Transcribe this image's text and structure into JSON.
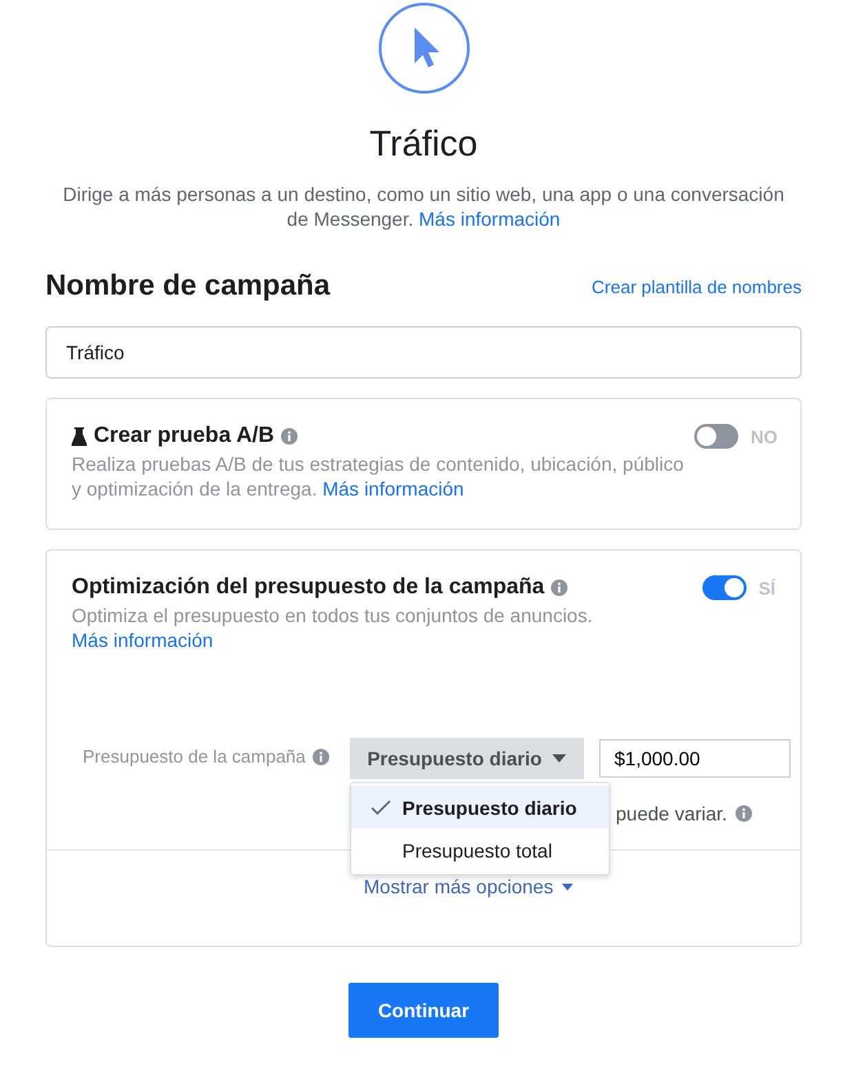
{
  "header": {
    "title": "Tráfico",
    "description": "Dirige a más personas a un destino, como un sitio web, una app o una conversación de Messenger.",
    "link": "Más información"
  },
  "campaign_name": {
    "heading": "Nombre de campaña",
    "template_link": "Crear plantilla de nombres",
    "value": "Tráfico"
  },
  "ab_test": {
    "title": "Crear prueba A/B",
    "description": "Realiza pruebas A/B de tus estrategias de contenido, ubicación, público y optimización de la entrega.",
    "link": "Más información",
    "on": false,
    "toggle_label": "NO"
  },
  "budget_optimization": {
    "title": "Optimización del presupuesto de la campaña",
    "description": "Optimiza el presupuesto en todos tus conjuntos de anuncios.",
    "link": "Más información",
    "on": true,
    "toggle_label": "SÍ",
    "budget_label": "Presupuesto de la campaña",
    "budget_type": "Presupuesto diario",
    "amount": "$1,000.00",
    "note": "puede variar.",
    "menu": [
      {
        "label": "Presupuesto diario",
        "selected": true
      },
      {
        "label": "Presupuesto total",
        "selected": false
      }
    ],
    "more_options": "Mostrar más opciones"
  },
  "continue_button": "Continuar"
}
